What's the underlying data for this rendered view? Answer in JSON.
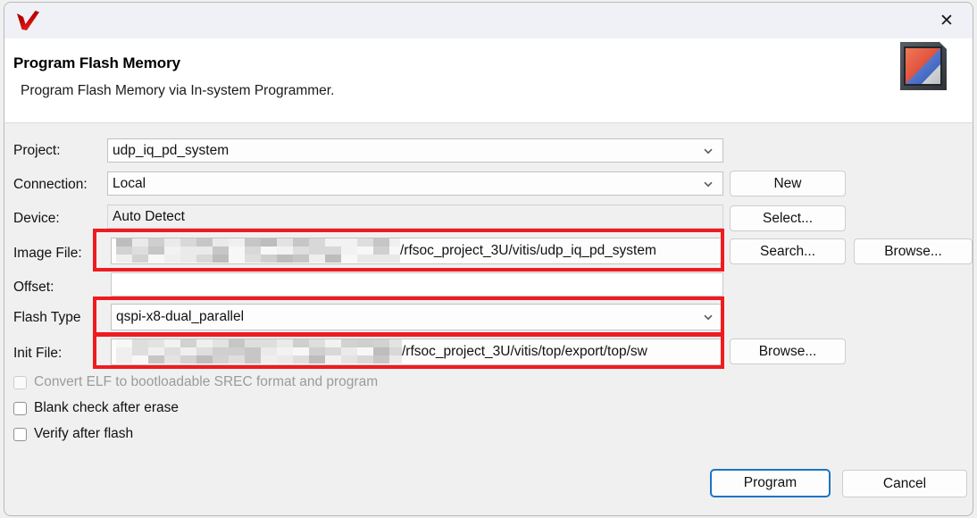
{
  "window": {
    "close_label": "✕",
    "logo_icon": "vitis-checkmark-logo",
    "banner_icon": "flash-memory-banner-icon"
  },
  "banner": {
    "title": "Program Flash Memory",
    "subtitle": "Program Flash Memory via In-system Programmer."
  },
  "form": {
    "project": {
      "label": "Project:",
      "value": "udp_iq_pd_system"
    },
    "connection": {
      "label": "Connection:",
      "value": "Local",
      "button": "New"
    },
    "device": {
      "label": "Device:",
      "value": "Auto Detect",
      "button": "Select..."
    },
    "image_file": {
      "label": "Image File:",
      "value": "/rfsoc_project_3U/vitis/udp_iq_pd_system",
      "redacted_prefix": true,
      "button_primary": "Search...",
      "button_secondary": "Browse..."
    },
    "offset": {
      "label": "Offset:",
      "value": ""
    },
    "flash_type": {
      "label": "Flash Type",
      "value": "qspi-x8-dual_parallel"
    },
    "init_file": {
      "label": "Init File:",
      "value": "/rfsoc_project_3U/vitis/top/export/top/sw",
      "redacted_prefix": true,
      "button": "Browse..."
    }
  },
  "options": [
    {
      "label": "Convert ELF to bootloadable SREC format and program",
      "checked": false,
      "disabled": true
    },
    {
      "label": "Blank check after erase",
      "checked": false,
      "disabled": false
    },
    {
      "label": "Verify after flash",
      "checked": false,
      "disabled": false
    }
  ],
  "actions": {
    "program": "Program",
    "cancel": "Cancel"
  },
  "colors": {
    "annotation": "#ee1b20",
    "focus": "#1e74c4",
    "logo_red": "#c00000"
  }
}
